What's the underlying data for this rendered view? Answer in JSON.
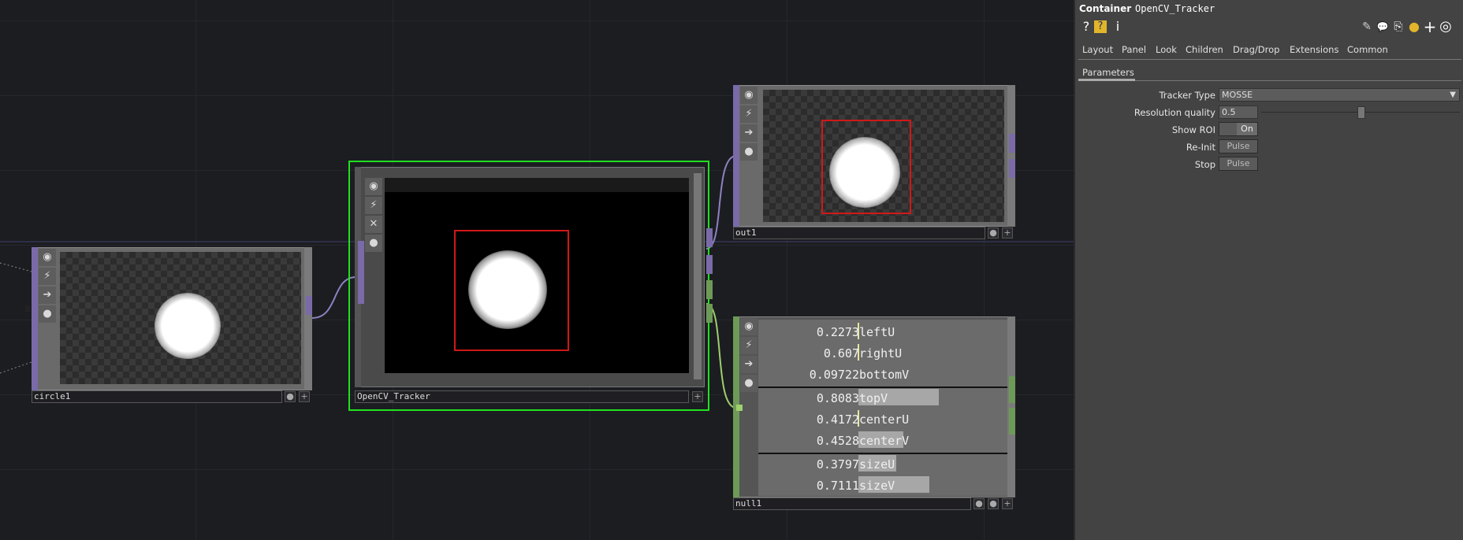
{
  "network": {
    "nodes": {
      "circle1": {
        "name": "circle1"
      },
      "tracker": {
        "name": "OpenCV_Tracker"
      },
      "out1": {
        "name": "out1"
      },
      "null1": {
        "name": "null1",
        "rows": [
          {
            "value": "0.2273",
            "label": "leftU",
            "bar": 0.0
          },
          {
            "value": "0.607",
            "label": "rightU",
            "bar": 0.0
          },
          {
            "value": "0.09722",
            "label": "bottomV",
            "bar": 0.0
          },
          {
            "value": "0.8083",
            "label": "topV",
            "bar": 0.8083
          },
          {
            "value": "0.4172",
            "label": "centerU",
            "bar": 0.0
          },
          {
            "value": "0.4528",
            "label": "centerV",
            "bar": 0.4528
          },
          {
            "value": "0.3797",
            "label": "sizeU",
            "bar": 0.3797
          },
          {
            "value": "0.7111",
            "label": "sizeV",
            "bar": 0.7111
          }
        ]
      }
    }
  },
  "panel": {
    "type_label": "Container",
    "op_name": "OpenCV_Tracker",
    "toolbar_icons": [
      "help-icon",
      "python-help-icon",
      "info-icon",
      "edit-icon",
      "comment-icon",
      "clone-icon",
      "python-icon",
      "add-icon",
      "target-icon"
    ],
    "toolbar_glyphs": {
      "help": "?",
      "pyhelp": "?",
      "info": "i",
      "edit": "✎",
      "comment": "💬",
      "clone": "⎘",
      "python": "●",
      "add": "+",
      "target": "◎"
    },
    "tabs": [
      "Layout",
      "Panel",
      "Look",
      "Children",
      "Drag/Drop",
      "Extensions",
      "Common"
    ],
    "subtab": "Parameters",
    "params": {
      "tracker_type": {
        "label": "Tracker Type",
        "value": "MOSSE"
      },
      "resolution": {
        "label": "Resolution quality",
        "value": "0.5",
        "slider": 0.5
      },
      "show_roi": {
        "label": "Show ROI",
        "value": "On"
      },
      "reinit": {
        "label": "Re-Init",
        "button": "Pulse"
      },
      "stop": {
        "label": "Stop",
        "button": "Pulse"
      }
    }
  },
  "colors": {
    "top_node": "#7a6aa8",
    "chop_node": "#6e9a58",
    "selection": "#20e020",
    "roi": "#d01818"
  }
}
